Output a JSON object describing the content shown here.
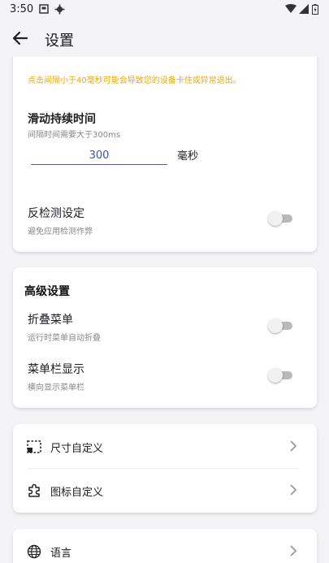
{
  "status_bar": {
    "time": "3:50"
  },
  "header": {
    "title": "设置"
  },
  "touch_card": {
    "warning": "点击间隔小于40毫秒可能会导致您的设备卡住或异常退出。",
    "swipe_duration": {
      "title": "滑动持续时间",
      "desc": "间隔时间需要大于300ms",
      "value": "300",
      "unit": "毫秒"
    },
    "anti_detect": {
      "title": "反检测设定",
      "desc": "避免应用检测作弊",
      "enabled": false
    }
  },
  "advanced": {
    "title": "高级设置",
    "fold_menu": {
      "title": "折叠菜单",
      "desc": "运行时菜单自动折叠",
      "enabled": false
    },
    "menubar_display": {
      "title": "菜单栏显示",
      "desc": "横向显示菜单栏",
      "enabled": false
    }
  },
  "customize": {
    "items": [
      {
        "label": "尺寸自定义",
        "icon": "resize-icon"
      },
      {
        "label": "图标自定义",
        "icon": "puzzle-icon"
      }
    ]
  },
  "language": {
    "label": "语言",
    "icon": "globe-icon"
  },
  "colors": {
    "background": "#f4f4f6",
    "warning": "#f2a900",
    "input_text": "#3f4fb5",
    "switch_off_track": "#b9b9b9"
  }
}
